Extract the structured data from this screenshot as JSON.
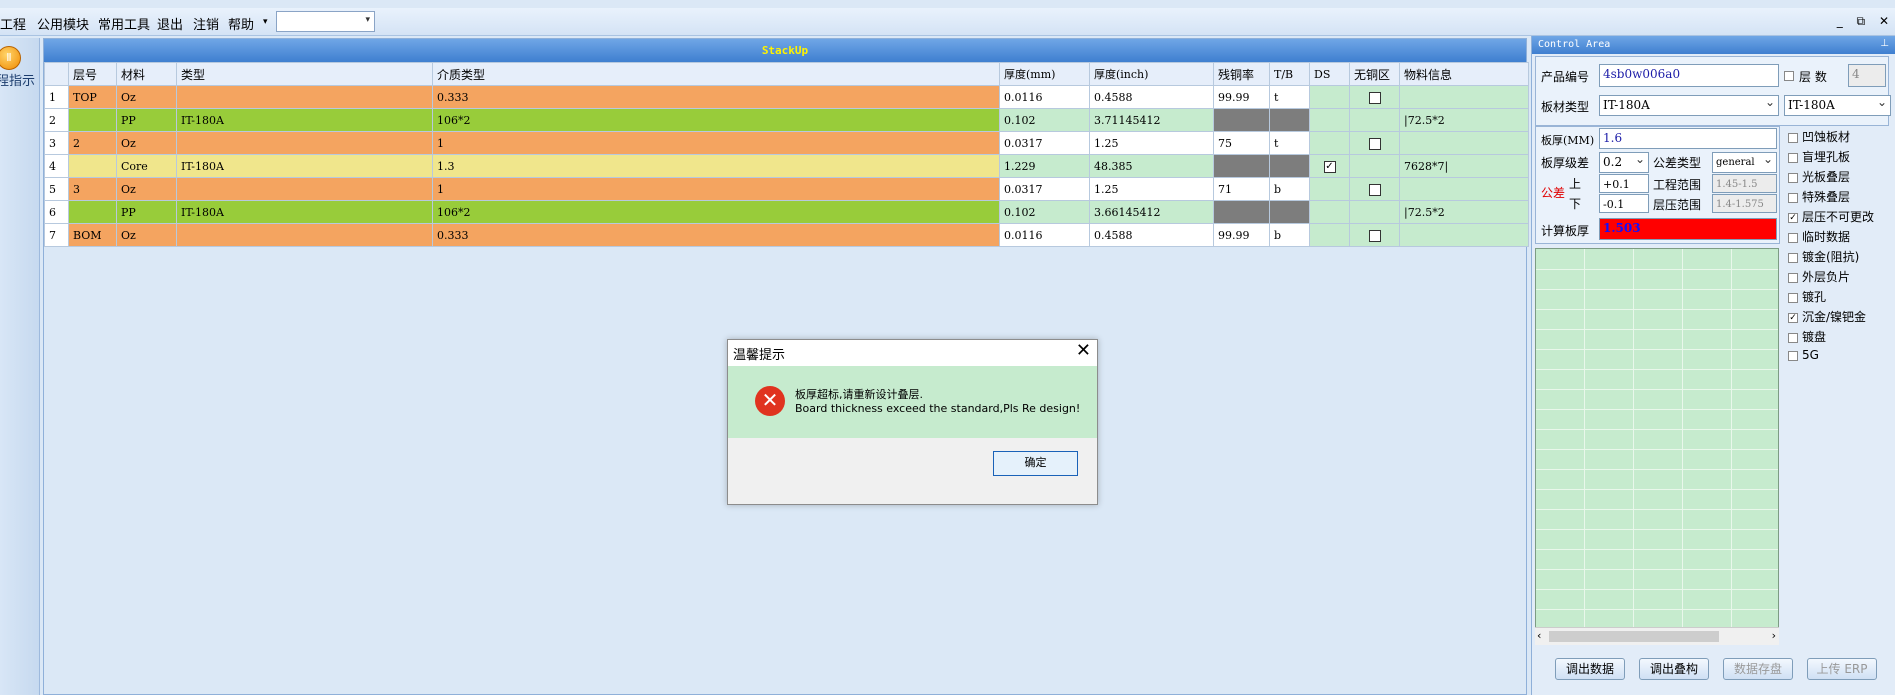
{
  "window": {
    "title": "",
    "controls": [
      "_",
      "⧉",
      "✕"
    ]
  },
  "menubar": {
    "items": [
      "工程",
      "公用模块",
      "常用工具",
      "退出",
      "注销",
      "帮助"
    ],
    "combo_value": ""
  },
  "sidebar": {
    "button_label": "程指示"
  },
  "stackup": {
    "title": "StackUp",
    "columns": [
      "",
      "层号",
      "材料",
      "类型",
      "介质类型",
      "厚度(mm)",
      "厚度(inch)",
      "残铜率",
      "T/B",
      "DS",
      "无铜区",
      "物料信息"
    ],
    "rows": [
      {
        "no": "1",
        "layer": "TOP",
        "material": "Oz",
        "type": "",
        "dielectric": "0.333",
        "mm": "0.0116",
        "inch": "0.4588",
        "residual": "99.99",
        "tb": "t",
        "ds": "",
        "nocopper": "unchecked",
        "info": ""
      },
      {
        "no": "2",
        "layer": "",
        "material": "PP",
        "type": "IT-180A",
        "dielectric": "106*2",
        "mm": "0.102",
        "inch": "3.71145412",
        "residual": "",
        "tb": "",
        "ds": "",
        "nocopper": "",
        "info": "|72.5*2"
      },
      {
        "no": "3",
        "layer": "2",
        "material": "Oz",
        "type": "",
        "dielectric": "1",
        "mm": "0.0317",
        "inch": "1.25",
        "residual": "75",
        "tb": "t",
        "ds": "",
        "nocopper": "unchecked",
        "info": ""
      },
      {
        "no": "4",
        "layer": "",
        "material": "Core",
        "type": "IT-180A",
        "dielectric": "1.3",
        "mm": "1.229",
        "inch": "48.385",
        "residual": "",
        "tb": "",
        "ds": "checked",
        "nocopper": "",
        "info": "7628*7|"
      },
      {
        "no": "5",
        "layer": "3",
        "material": "Oz",
        "type": "",
        "dielectric": "1",
        "mm": "0.0317",
        "inch": "1.25",
        "residual": "71",
        "tb": "b",
        "ds": "",
        "nocopper": "unchecked",
        "info": ""
      },
      {
        "no": "6",
        "layer": "",
        "material": "PP",
        "type": "IT-180A",
        "dielectric": "106*2",
        "mm": "0.102",
        "inch": "3.66145412",
        "residual": "",
        "tb": "",
        "ds": "",
        "nocopper": "",
        "info": "|72.5*2"
      },
      {
        "no": "7",
        "layer": "BOM",
        "material": "Oz",
        "type": "",
        "dielectric": "0.333",
        "mm": "0.0116",
        "inch": "0.4588",
        "residual": "99.99",
        "tb": "b",
        "ds": "",
        "nocopper": "unchecked",
        "info": ""
      }
    ]
  },
  "dialog": {
    "title": "温馨提示",
    "message_cn": "板厚超标,请重新设计叠层.",
    "message_en": "Board thickness exceed the standard,Pls Re design!",
    "ok_label": "确定"
  },
  "control": {
    "title": "Control Area",
    "product_label": "产品编号",
    "product_value": "4sb0w006a0",
    "layers_label": "层 数",
    "layers_value": "4",
    "board_type_label": "板材类型",
    "board_type_value": "IT-180A",
    "board_type_value2": "IT-180A",
    "thickness_label": "板厚(MM)",
    "thickness_value": "1.6",
    "tol_level_label": "板厚级差",
    "tol_level_value": "0.2",
    "tol_type_label": "公差类型",
    "tol_type_value": "general",
    "tol_label": "公差",
    "upper_label": "上",
    "lower_label": "下",
    "upper_value": "+0.1",
    "lower_value": "-0.1",
    "eng_range_label": "工程范围",
    "eng_range_value": "1.45-1.5",
    "press_range_label": "层压范围",
    "press_range_value": "1.4-1.575",
    "calc_label": "计算板厚",
    "calc_value": "1.503",
    "checks": [
      {
        "label": "凹蚀板材",
        "checked": false
      },
      {
        "label": "盲埋孔板",
        "checked": false
      },
      {
        "label": "光板叠层",
        "checked": false
      },
      {
        "label": "特殊叠层",
        "checked": false
      },
      {
        "label": "层压不可更改",
        "checked": true
      },
      {
        "label": "临时数据",
        "checked": false
      },
      {
        "label": "镀金(阻抗)",
        "checked": false
      },
      {
        "label": "外层负片",
        "checked": false
      },
      {
        "label": "镀孔",
        "checked": false
      },
      {
        "label": "沉金/镍钯金",
        "checked": true
      },
      {
        "label": "镀盘",
        "checked": false
      },
      {
        "label": "5G",
        "checked": false
      }
    ],
    "buttons": [
      {
        "label": "调出数据",
        "enabled": true
      },
      {
        "label": "调出叠构",
        "enabled": true
      },
      {
        "label": "数据存盘",
        "enabled": false
      },
      {
        "label": "上传 ERP",
        "enabled": false
      }
    ]
  },
  "colors": {
    "copper_row": "#f4a460",
    "pp_row": "#98cc3a",
    "core_row": "#f0e68c",
    "calc_bg": "#ff0000",
    "calc_text": "#1010ff"
  }
}
